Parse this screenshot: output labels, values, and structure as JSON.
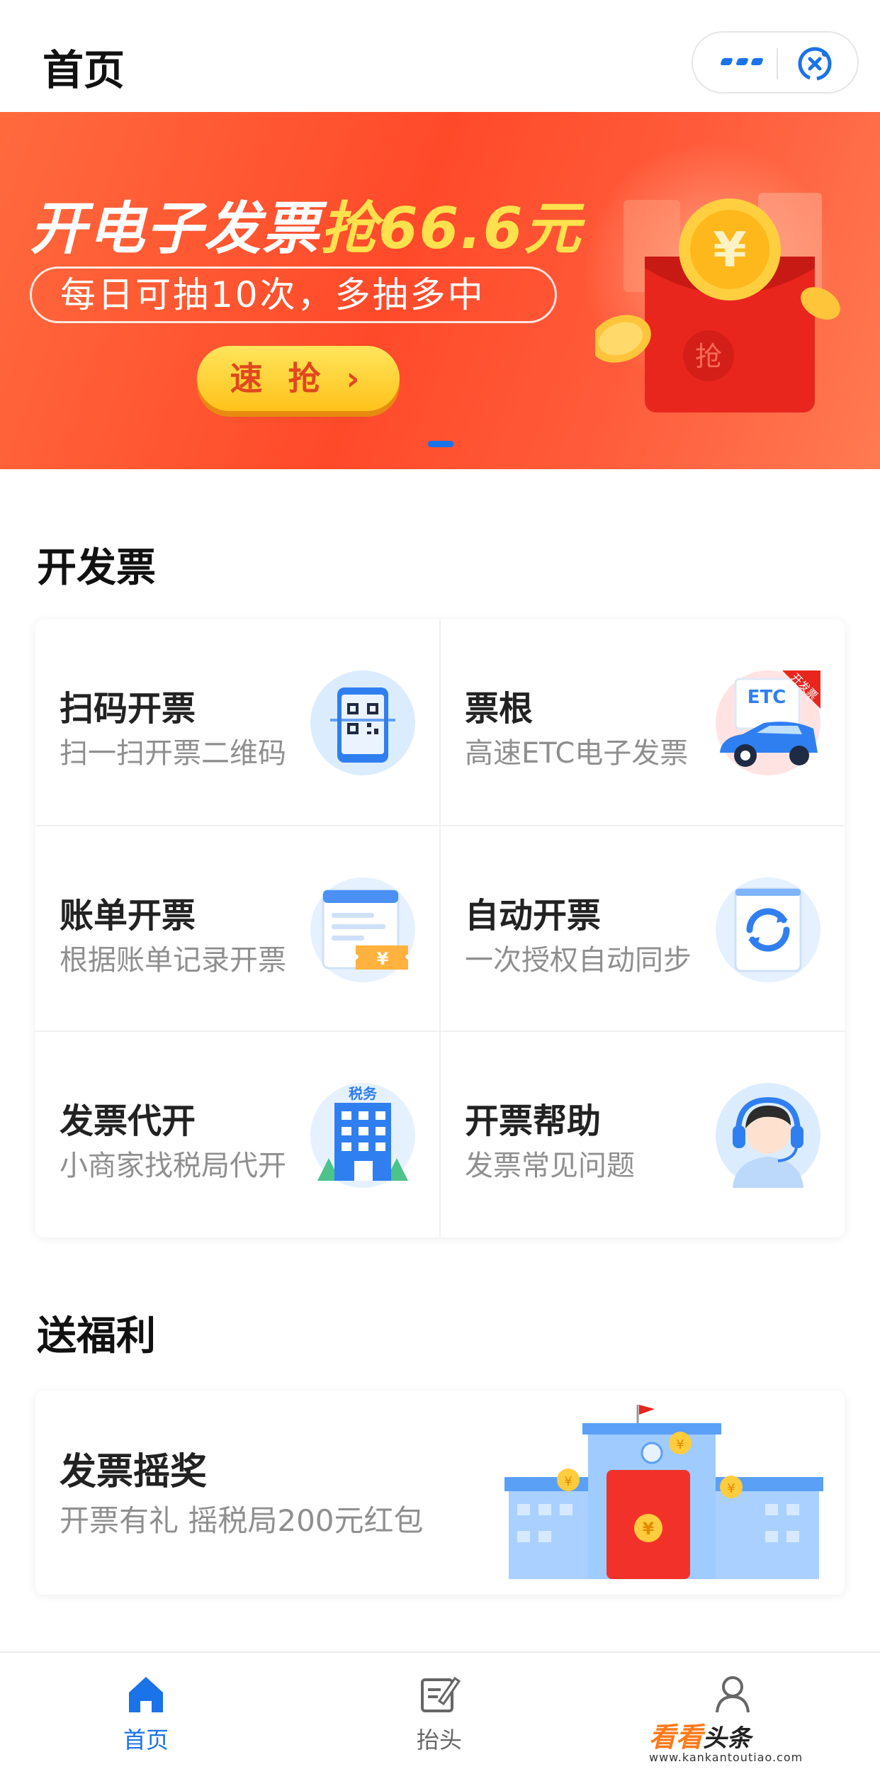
{
  "header": {
    "title": "首页",
    "more_icon": "more-dots-icon",
    "close_icon": "target-close-icon"
  },
  "banner": {
    "title_main": "开电子发票",
    "title_highlight": "抢66.6元",
    "subtitle": "每日可抽10次，多抽多中",
    "button_label": "速 抢 ›",
    "envelope_mark": "抢",
    "colors": {
      "bg": "#ff4a2a",
      "highlight": "#ffe14d",
      "button": "#ffc21a"
    }
  },
  "invoice_section": {
    "title": "开发票",
    "items": [
      {
        "title": "扫码开票",
        "subtitle": "扫一扫开票二维码",
        "icon": "qr-scan-icon"
      },
      {
        "title": "票根",
        "subtitle": "高速ETC电子发票",
        "icon": "etc-car-icon",
        "icon_tag": "ETC",
        "icon_ribbon": "开发票"
      },
      {
        "title": "账单开票",
        "subtitle": "根据账单记录开票",
        "icon": "bill-ticket-icon"
      },
      {
        "title": "自动开票",
        "subtitle": "一次授权自动同步",
        "icon": "auto-sync-icon"
      },
      {
        "title": "发票代开",
        "subtitle": "小商家找税局代开",
        "icon": "tax-building-icon",
        "icon_tag": "税务"
      },
      {
        "title": "开票帮助",
        "subtitle": "发票常见问题",
        "icon": "headset-support-icon"
      }
    ]
  },
  "welfare_section": {
    "title": "送福利",
    "card": {
      "title": "发票摇奖",
      "subtitle": "开票有礼 摇税局200元红包",
      "icon": "red-envelope-building-icon"
    }
  },
  "tabbar": {
    "tabs": [
      {
        "label": "首页",
        "icon": "home-icon",
        "active": true
      },
      {
        "label": "抬头",
        "icon": "edit-note-icon",
        "active": false
      },
      {
        "label": "",
        "icon": "person-icon",
        "active": false
      }
    ],
    "accent": "#1a73e8"
  },
  "watermark": {
    "brand_a": "看看",
    "brand_b": "头条",
    "url": "www.kankantoutiao.com"
  }
}
